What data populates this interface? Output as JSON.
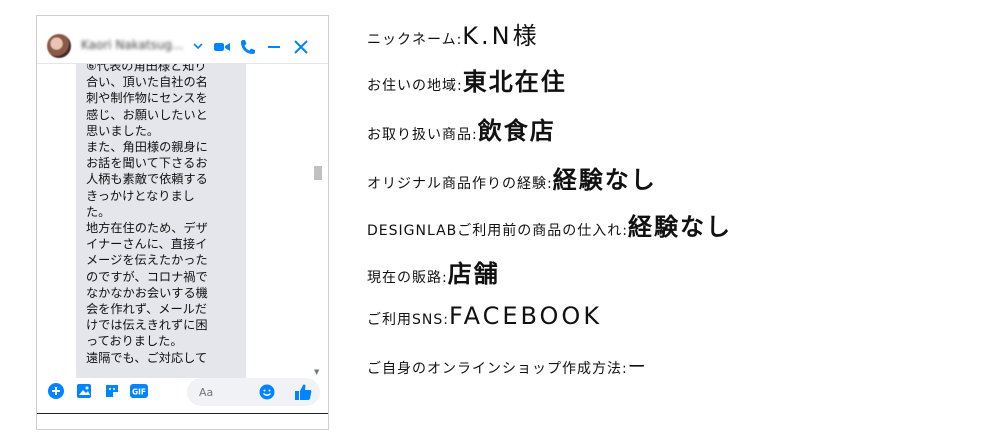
{
  "chat": {
    "contact_name": "Kaori Nakatsug...",
    "message": "⑥代表の角田様と知り\n合い、頂いた自社の名\n刺や制作物にセンスを\n感じ、お願いしたいと\n思いました。\nまた、角田様の親身に\nお話を聞いて下さるお\n人柄も素敵で依頼する\nきっかけとなりまし\nた。\n地方在住のため、デザ\nイナーさんに、直接イ\nメージを伝えたかった\nのですが、コロナ禍で\nなかなかお会いする機\n会を作れず、メールだ\nけでは伝えきれずに困\nっておりました。\n遠隔でも、ご対応して",
    "input_placeholder": "Aa",
    "gif_label": "GIF",
    "colors": {
      "accent": "#0084ff",
      "bubble": "#e4e6eb"
    }
  },
  "info": [
    {
      "label": "ニックネーム:",
      "value": "K.N様"
    },
    {
      "label": "お住いの地域:",
      "value": "東北在住"
    },
    {
      "label": "お取り扱い商品:",
      "value": "飲食店"
    },
    {
      "label": "オリジナル商品作りの経験:",
      "value": "経験なし"
    },
    {
      "label": "DESIGNLABご利用前の商品の仕入れ:",
      "value": "経験なし"
    },
    {
      "label": "現在の販路:",
      "value": "店舗"
    },
    {
      "label": "ご利用SNS:",
      "value": "FACEBOOK"
    },
    {
      "label": "ご自身のオンラインショップ作成方法:",
      "value": "ー"
    }
  ]
}
